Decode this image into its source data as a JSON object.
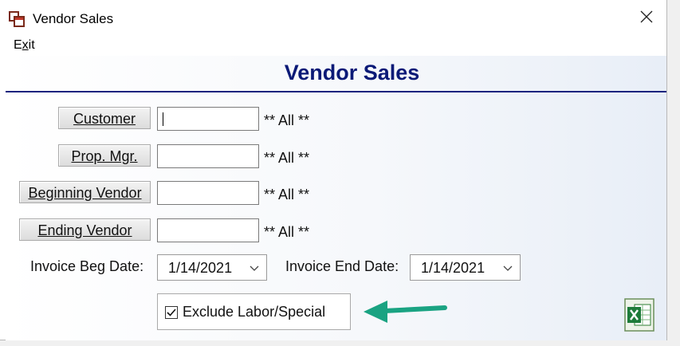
{
  "window": {
    "title": "Vendor Sales"
  },
  "menu": {
    "exit_prefix": "E",
    "exit_underlined": "x",
    "exit_suffix": "it"
  },
  "form": {
    "title": "Vendor Sales",
    "fields": [
      {
        "button_label": "Customer",
        "value": "",
        "note": "** All **"
      },
      {
        "button_label": "Prop. Mgr.",
        "value": "",
        "note": "** All **"
      },
      {
        "button_label": "Beginning Vendor",
        "value": "",
        "note": "** All **"
      },
      {
        "button_label": "Ending Vendor",
        "value": "",
        "note": "** All **"
      }
    ],
    "invoice_beg": {
      "label": "Invoice Beg Date:",
      "value": "1/14/2021"
    },
    "invoice_end": {
      "label": "Invoice End Date:",
      "value": "1/14/2021"
    },
    "exclude": {
      "label": "Exclude Labor/Special",
      "checked": true
    }
  },
  "colors": {
    "title_blue": "#0b1a77",
    "arrow_teal": "#1aa382",
    "excel_green": "#1e7b3a"
  },
  "icons": [
    "app-icon",
    "close-icon",
    "chevron-down-icon",
    "arrow-left-icon",
    "excel-icon"
  ]
}
